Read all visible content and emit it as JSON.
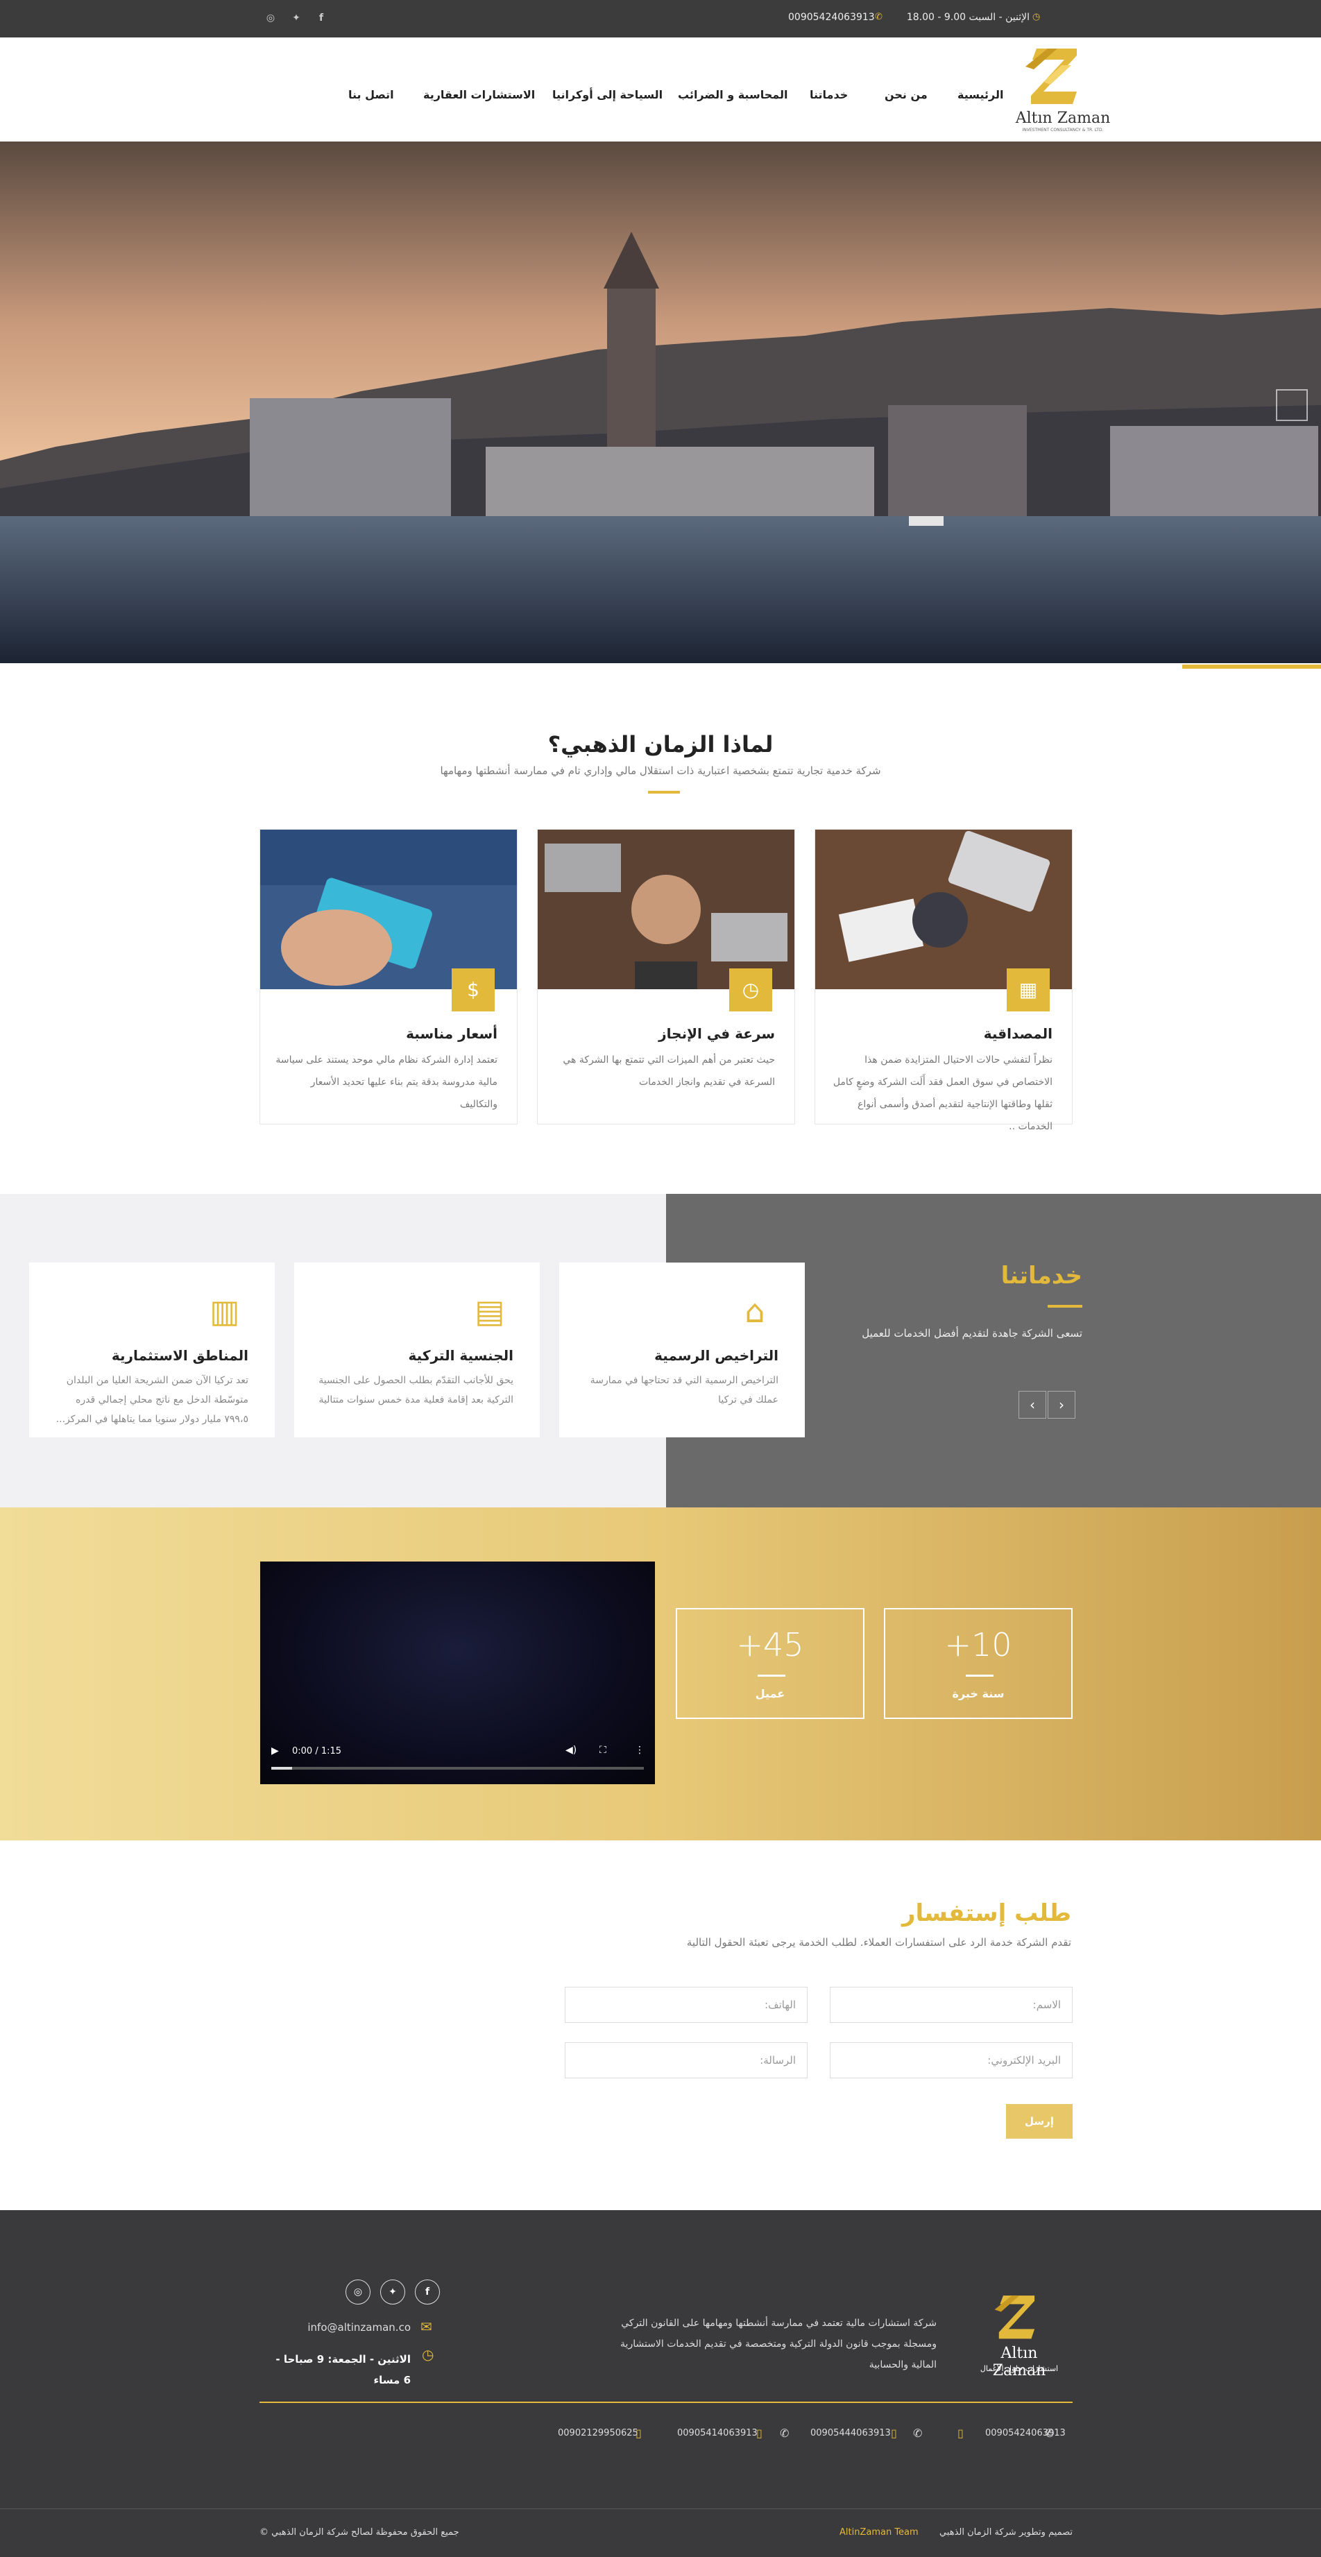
{
  "topbar": {
    "hours": "الإثنين - السبت  9.00 - 18.00",
    "phone": "00905424063913",
    "social": [
      "instagram-icon",
      "twitter-icon",
      "facebook-icon"
    ]
  },
  "header": {
    "logo_text": "Altın Zaman",
    "logo_sub": "INVESTMENT CONSULTANCY & TR. LTD.",
    "nav": [
      "الرئيسية",
      "من نحن",
      "خدماتنا",
      "المحاسبة و الضرائب",
      "السياحة إلى أوكرانيا",
      "الاستشارات العقارية",
      "اتصل بنا"
    ]
  },
  "why": {
    "title": "لماذا الزمان الذهبي؟",
    "subtitle": "شركة خدمية تجارية تتمتع بشخصية اعتبارية ذات استقلال مالي وإداري تام في ممارسة أنشطتها ومهامها",
    "cards": [
      {
        "title": "المصداقية",
        "text": "نظراً لتفشي حالات الاحتيال المتزايدة ضمن هذا الاختصاص في سوق العمل فقد أَلَت الشركة وضعٍ كامل ثقلها وطاقتها الإنتاجية لتقديم أصدق وأسمى أنواع الخدمات ..",
        "icon": "presentation-icon"
      },
      {
        "title": "سرعة في الإنجاز",
        "text": "حيث تعتبر من أهم الميزات التي تتمتع بها الشركة هي السرعة في تقديم وانجاز الخدمات",
        "icon": "clock-icon"
      },
      {
        "title": "أسعار مناسبة",
        "text": "تعتمد إدارة الشركة نظام مالي موحد يستند على سياسة مالية مدروسة بدقة يتم بناء عليها تحديد الأسعار والتكاليف",
        "icon": "money-bag-icon"
      }
    ]
  },
  "services": {
    "title": "خدماتنا",
    "subtitle": "تسعى الشركة جاهدة لتقديم أفضل الخدمات للعميل",
    "cards": [
      {
        "title": "التراخيص الرسمية",
        "text": "التراخيص الرسمية التي قد تحتاجها في ممارسة عملك في تركيا",
        "icon": "bank-icon"
      },
      {
        "title": "الجنسية التركية",
        "text": "يحق للأجانب التقدّم بطلب الحصول على الجنسية التركية بعد إقامة فعلية مدة خمس سنوات متتالية",
        "icon": "book-icon"
      },
      {
        "title": "المناطق الاستثمارية",
        "text": "تعد تركيا الآن ضمن الشريحة العليا من البلدان متوسّطة الدخل مع ناتج محلي إجمالي قدره ٧٩٩،٥ مليار دولار سنويا مما يتاهلها في المركز...",
        "icon": "building-icon"
      }
    ],
    "prev": "‹",
    "next": "›"
  },
  "stats": [
    {
      "num": "+10",
      "label": "سنة خبرة"
    },
    {
      "num": "+45",
      "label": "عميل"
    }
  ],
  "video": {
    "time": "0:00 / 1:15"
  },
  "contact": {
    "title": "طلب إستفسار",
    "subtitle": "تقدم الشركة خدمة الرد على استفسارات العملاء. لطلب الخدمة يرجى تعبئة الحقول التالية",
    "name_ph": "الاسم:",
    "phone_ph": "الهاتف:",
    "email_ph": "البريد الإلكتروني:",
    "message_ph": "الرسالة:",
    "submit": "إرسل"
  },
  "footer": {
    "logo_text": "Altın Zaman",
    "logo_sub": "استشارات حلول الأعمال",
    "about": "شركة استشارات مالية تعتمد في ممارسة أنشطتها ومهامها على القانون التركي ومسجلة بموجب قانون الدولة التركية ومتخصصة في تقديم الخدمات الاستشارية المالية والحسابية",
    "email": "info@altinzaman.co",
    "hours": "الاثنين - الجمعة: 9 صباحا - 6 مساء",
    "phones": [
      "00905424063913",
      "00905444063913",
      "00905414063913",
      "00902129950625"
    ],
    "copyright": "جميع الحقوق محفوظة لصالح شركة الزمان الذهبي ©",
    "credit_prefix": "تصميم وتطوير شركة الزمان الذهبي",
    "credit_team": "AltinZaman Team"
  },
  "colors": {
    "accent": "#e2b93b",
    "dark": "#3c3c3c",
    "gray_panel": "#6a6a6b"
  }
}
